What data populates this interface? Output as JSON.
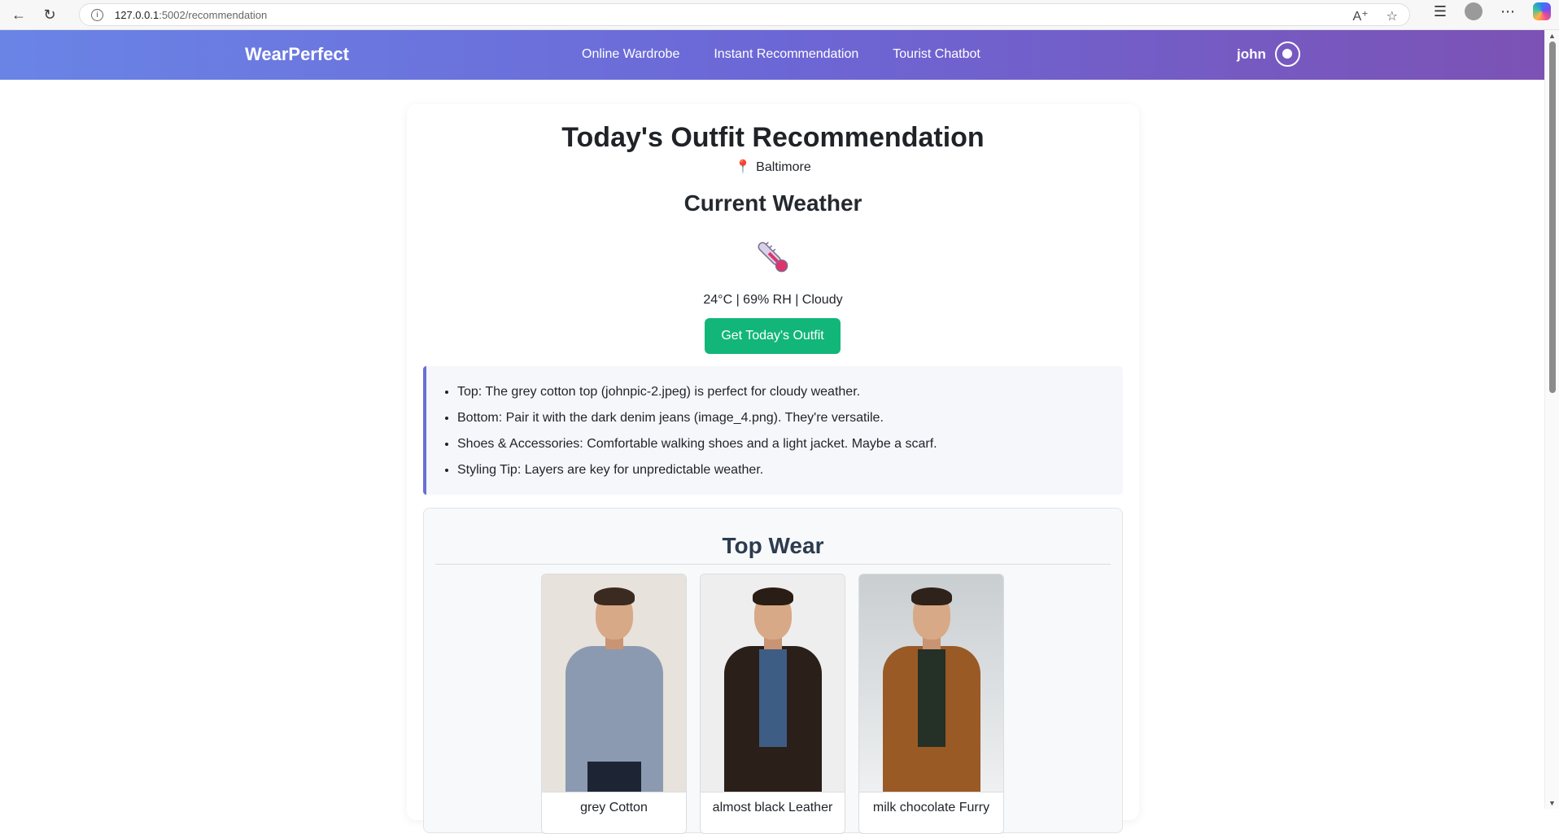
{
  "browser": {
    "url_host": "127.0.0.1",
    "url_path": ":5002/recommendation"
  },
  "header": {
    "brand": "WearPerfect",
    "nav": [
      "Online Wardrobe",
      "Instant Recommendation",
      "Tourist Chatbot"
    ],
    "user": "john"
  },
  "main": {
    "title": "Today's Outfit Recommendation",
    "location": "Baltimore",
    "weather_title": "Current Weather",
    "weather_readout": "24°C | 69% RH | Cloudy",
    "button_label": "Get Today's Outfit",
    "tips": [
      "Top: The grey cotton top (johnpic-2.jpeg) is perfect for cloudy weather.",
      "Bottom: Pair it with the dark denim jeans (image_4.png). They're versatile.",
      "Shoes & Accessories: Comfortable walking shoes and a light jacket. Maybe a scarf.",
      "Styling Tip: Layers are key for unpredictable weather."
    ],
    "section_title": "Top Wear",
    "items": [
      {
        "label": "grey Cotton",
        "top_color": "#8b9ab0",
        "bg": "#e7e2dc"
      },
      {
        "label": "almost black Leather",
        "top_color": "#2b1f1a",
        "bg": "#eeeeee"
      },
      {
        "label": "milk chocolate Furry",
        "top_color": "#9a5a25",
        "bg": "#dfe3e5"
      }
    ]
  },
  "colors": {
    "header_gradient_start": "#6a84e6",
    "header_gradient_end": "#7c52b5",
    "button": "#13b679",
    "tips_border": "#6a6fd6"
  }
}
